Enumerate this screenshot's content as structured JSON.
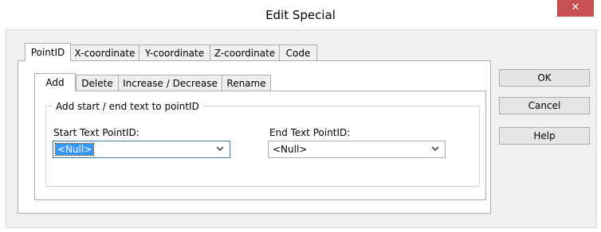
{
  "window": {
    "title": "Edit Special",
    "close_glyph": "✕"
  },
  "outer_tabs": [
    {
      "label": "PointID"
    },
    {
      "label": "X-coordinate"
    },
    {
      "label": "Y-coordinate"
    },
    {
      "label": "Z-coordinate"
    },
    {
      "label": "Code"
    }
  ],
  "inner_tabs": [
    {
      "label": "Add"
    },
    {
      "label": "Delete"
    },
    {
      "label": "Increase / Decrease"
    },
    {
      "label": "Rename"
    }
  ],
  "group": {
    "legend": "Add start / end text to pointID"
  },
  "start_text": {
    "label": "Start Text PointID:",
    "value": "<Null>"
  },
  "end_text": {
    "label": "End Text PointID:",
    "value": "<Null>"
  },
  "buttons": {
    "ok": "OK",
    "cancel": "Cancel",
    "help": "Help"
  },
  "colors": {
    "close": "#c75050",
    "selection": "#3399ff",
    "panel_bg": "#f0f0f0"
  }
}
